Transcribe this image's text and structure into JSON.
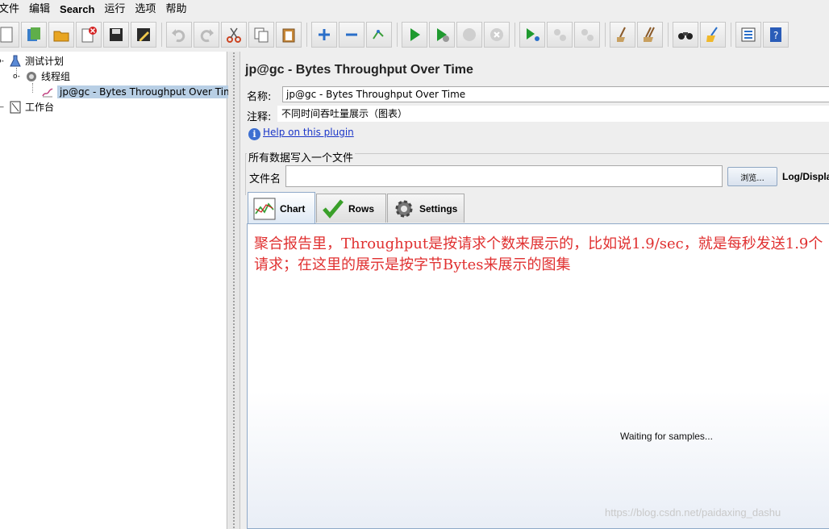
{
  "menu": [
    "文件",
    "编辑",
    "Search",
    "运行",
    "选项",
    "帮助"
  ],
  "toolbar": {
    "buttons": [
      "new",
      "templates",
      "open",
      "close",
      "save",
      "save-as-edit",
      "undo",
      "redo",
      "cut",
      "copy",
      "paste",
      "expand",
      "collapse",
      "toggle",
      "start",
      "start-no-pause",
      "stop",
      "shutdown",
      "remote-start",
      "remote-stop",
      "remote-shutdown",
      "clear",
      "clear-all",
      "search",
      "reset-search",
      "function-helper",
      "help"
    ]
  },
  "tree": {
    "items": [
      {
        "label": "测试计划",
        "icon": "test-plan-icon"
      },
      {
        "label": "线程组",
        "icon": "thread-group-icon"
      },
      {
        "label": "jp@gc - Bytes Throughput Over Time",
        "icon": "graph-icon"
      },
      {
        "label": "工作台",
        "icon": "workbench-icon"
      }
    ]
  },
  "panel": {
    "title": "jp@gc - Bytes Throughput Over Time",
    "name_label": "名称:",
    "name_value": "jp@gc - Bytes Throughput Over Time",
    "comment_label": "注释:",
    "comment_value": "不同时间吞吐量展示（图表）",
    "help_link": "Help on this plugin",
    "file_group_title": "所有数据写入一个文件",
    "filename_label": "文件名",
    "filename_value": "",
    "browse_label": "浏览...",
    "log_display_label": "Log/Displa"
  },
  "tabs": [
    {
      "label": "Chart",
      "icon": "chart-icon",
      "active": true
    },
    {
      "label": "Rows",
      "icon": "checkmark-icon",
      "active": false
    },
    {
      "label": "Settings",
      "icon": "gear-icon",
      "active": false
    }
  ],
  "chart_area": {
    "annotation": "聚合报告里，Throughput是按请求个数来展示的，比如说1.9/sec，就是每秒发送1.9个请求；在这里的展示是按字节Bytes来展示的图集",
    "waiting_text": "Waiting for samples..."
  },
  "watermark": "https://blog.csdn.net/paidaxing_dashu"
}
